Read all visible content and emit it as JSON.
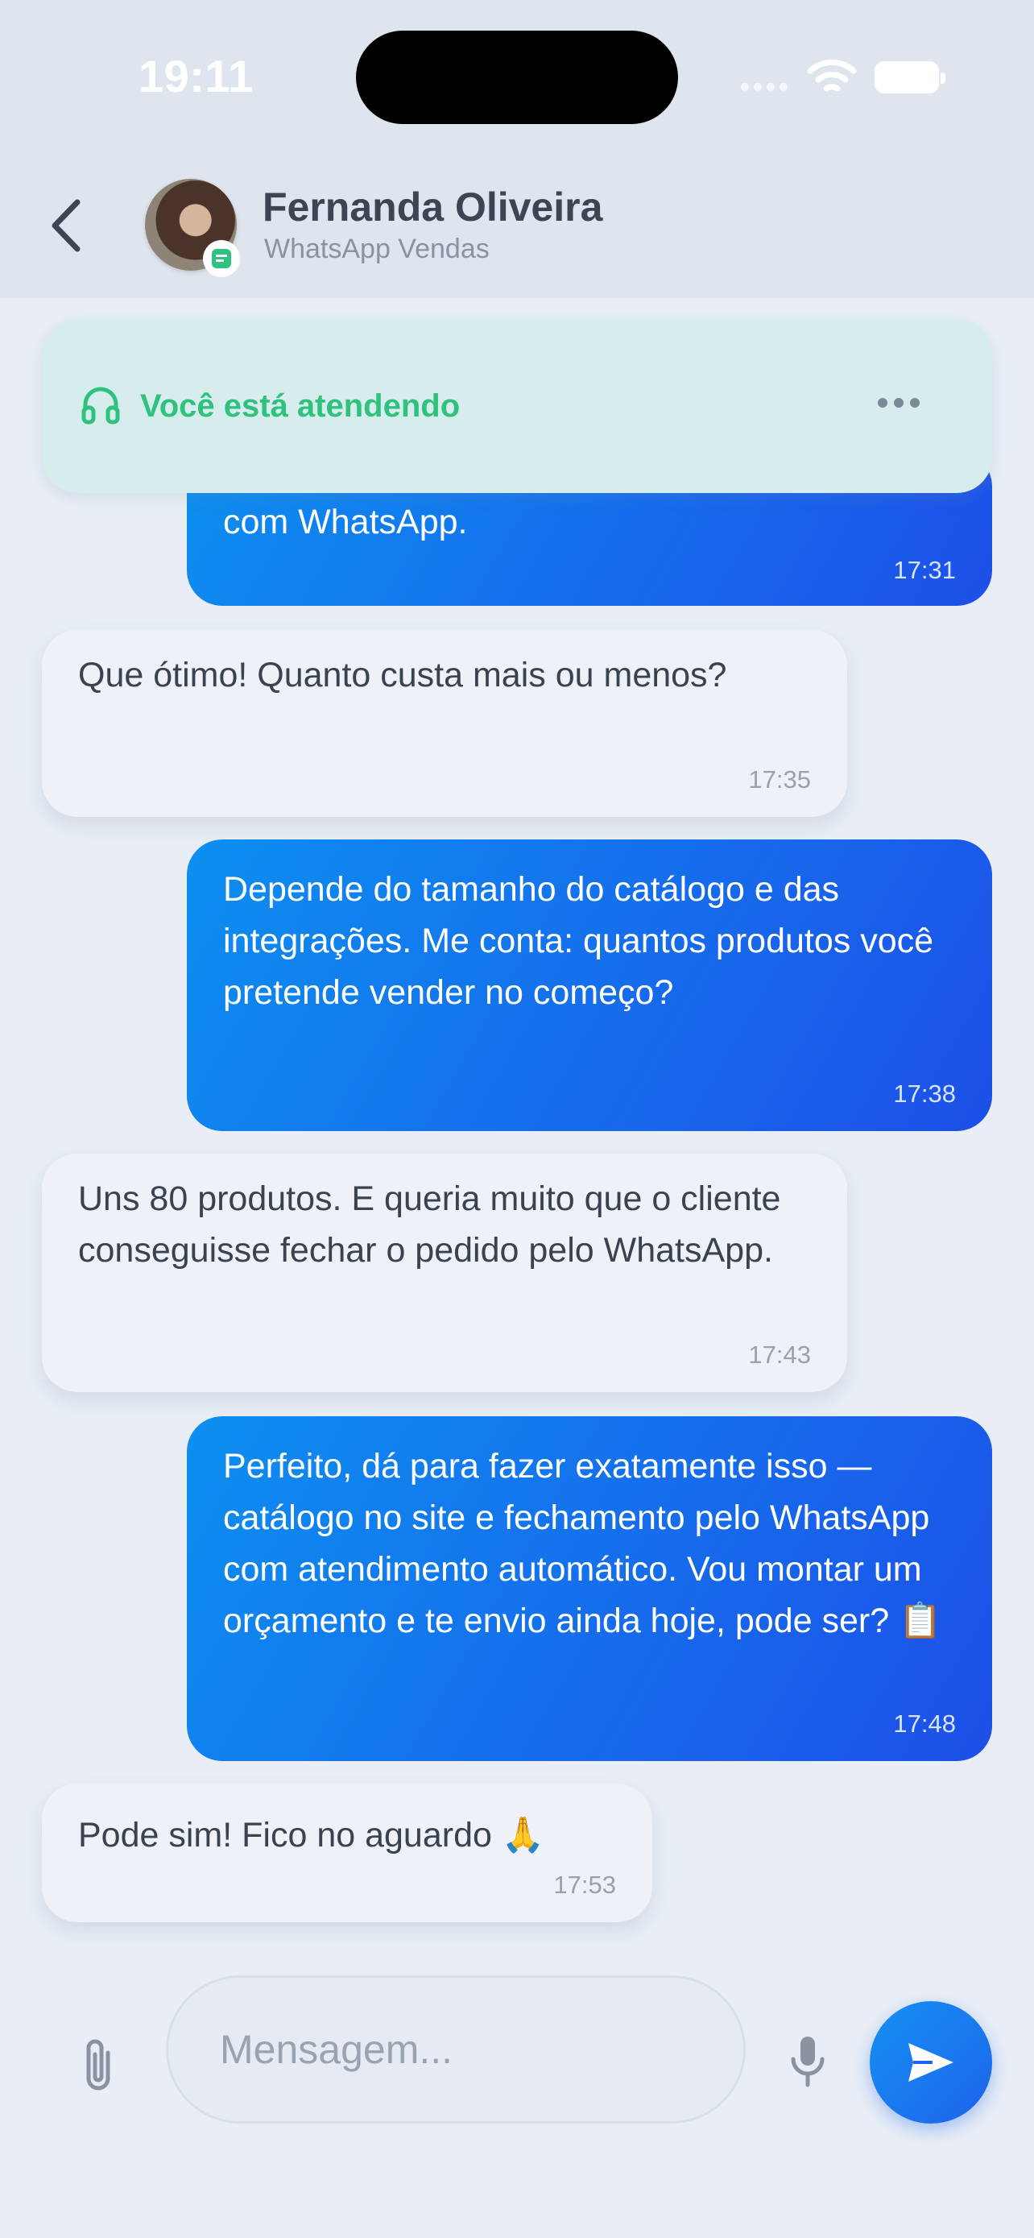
{
  "status_bar": {
    "time": "19:11"
  },
  "header": {
    "contact_name": "Fernanda Oliveira",
    "contact_subtitle": "WhatsApp Vendas"
  },
  "banner": {
    "label": "Você está atendendo"
  },
  "messages": [
    {
      "direction": "outgoing",
      "text": "com WhatsApp.",
      "time": "17:31"
    },
    {
      "direction": "incoming",
      "text": "Que ótimo! Quanto custa mais ou menos?",
      "time": "17:35"
    },
    {
      "direction": "outgoing",
      "text": "Depende do tamanho do catálogo e das integrações. Me conta: quantos produtos você pretende vender no começo?",
      "time": "17:38"
    },
    {
      "direction": "incoming",
      "text": "Uns 80 produtos. E queria muito que o cliente conseguisse fechar o pedido pelo WhatsApp.",
      "time": "17:43"
    },
    {
      "direction": "outgoing",
      "text": "Perfeito, dá para fazer exatamente isso — catálogo no site e fechamento pelo WhatsApp com atendimento automático. Vou montar um orçamento e te envio ainda hoje, pode ser? 📋",
      "time": "17:48"
    },
    {
      "direction": "incoming",
      "text": "Pode sim! Fico no aguardo 🙏",
      "time": "17:53"
    }
  ],
  "composer": {
    "placeholder": "Mensagem...",
    "value": ""
  },
  "colors": {
    "accent_green": "#2ec27e",
    "outgoing_bubble_start": "#0d8ff0",
    "outgoing_bubble_end": "#1d4fe8",
    "incoming_bubble": "#eef2f8",
    "send_button": "#1591f3"
  },
  "icons": [
    "back-chevron-icon",
    "chat-badge-icon",
    "headset-icon",
    "more-dots-icon",
    "paperclip-icon",
    "microphone-icon",
    "send-icon",
    "wifi-icon",
    "battery-icon",
    "signal-icon"
  ]
}
